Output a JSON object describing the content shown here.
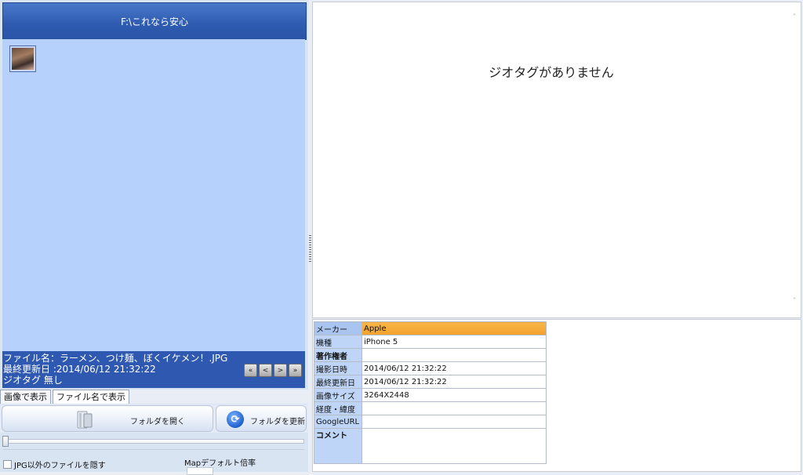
{
  "left": {
    "folder_title": "F:\\これなら安心",
    "info": {
      "filename_line": "ファイル名：ラーメン、つけ麺、ぼくイケメン！.JPG",
      "modified_line": "最終更新日 :2014/06/12 21:32:22",
      "geotag_line": "ジオタグ 無し"
    },
    "nav": {
      "first": "«",
      "prev": "<",
      "next": ">",
      "last": "»"
    },
    "tabs": [
      "画像で表示",
      "ファイル名で表示"
    ],
    "open_folder_label": "フォルダを開く",
    "refresh_folder_label": "フォルダを更新",
    "hide_non_jpg_label": "JPG以外のファイルを隠す",
    "map_zoom_label": "Mapデフォルト倍率"
  },
  "map": {
    "message": "ジオタグがありません",
    "scroll_up": "˄",
    "scroll_down": "˅"
  },
  "exif": {
    "rows": [
      {
        "key": "メーカー",
        "value": "Apple"
      },
      {
        "key": "機種",
        "value": "iPhone 5"
      },
      {
        "key": "著作権者",
        "value": ""
      },
      {
        "key": "撮影日時",
        "value": "2014/06/12 21:32:22"
      },
      {
        "key": "最終更新日",
        "value": "2014/06/12 21:32:22"
      },
      {
        "key": "画像サイズ",
        "value": "3264X2448"
      },
      {
        "key": "経度・緯度",
        "value": ""
      },
      {
        "key": "GoogleURL",
        "value": ""
      },
      {
        "key": "コメント",
        "value": ""
      }
    ]
  },
  "colors": {
    "header_blue": "#2e5bb0",
    "thumb_bg": "#b6d1fc",
    "selected_row": "#f3a12c"
  }
}
